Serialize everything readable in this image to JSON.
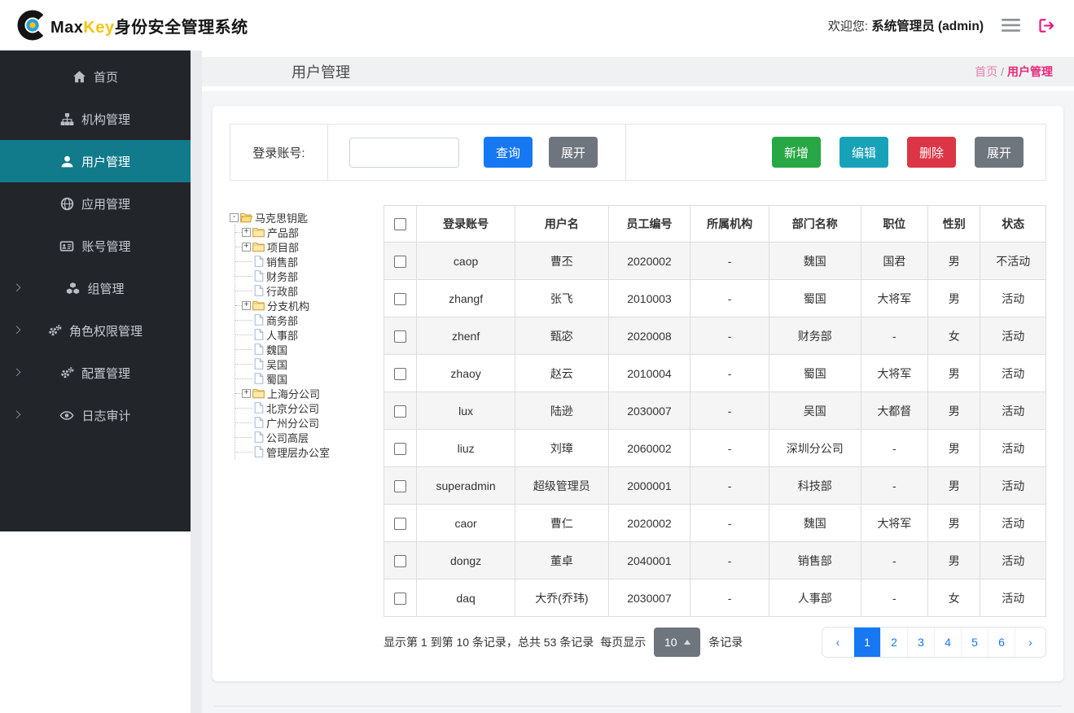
{
  "colors": {
    "primary_blue": "#1678f2",
    "success_green": "#28a745",
    "info_teal": "#17a2b8",
    "danger_red": "#dc3545",
    "secondary_gray": "#6e757c",
    "sidebar_active_teal": "#117a8b",
    "brand_pink": "#e72a7a",
    "brand_yellow": "#f3c414",
    "sidebar_bg": "#22262b"
  },
  "header": {
    "logo_max": "Max",
    "logo_key": "Key",
    "logo_suffix": "身份安全管理系统",
    "welcome_prefix": "欢迎您:",
    "welcome_user": "系统管理员 (admin)"
  },
  "sidebar": {
    "items": [
      {
        "key": "home",
        "label": "首页",
        "icon": "home-icon",
        "active": false,
        "has_chevron": false
      },
      {
        "key": "org-mgmt",
        "label": "机构管理",
        "icon": "sitemap-icon",
        "active": false,
        "has_chevron": false
      },
      {
        "key": "user-mgmt",
        "label": "用户管理",
        "icon": "user-icon",
        "active": true,
        "has_chevron": false
      },
      {
        "key": "app-mgmt",
        "label": "应用管理",
        "icon": "globe-icon",
        "active": false,
        "has_chevron": false
      },
      {
        "key": "account-mgmt",
        "label": "账号管理",
        "icon": "id-card-icon",
        "active": false,
        "has_chevron": false
      },
      {
        "key": "group-mgmt",
        "label": "组管理",
        "icon": "cubes-icon",
        "active": false,
        "has_chevron": true
      },
      {
        "key": "role-perm",
        "label": "角色权限管理",
        "icon": "gears-icon",
        "active": false,
        "has_chevron": true
      },
      {
        "key": "config-mgmt",
        "label": "配置管理",
        "icon": "gears-icon",
        "active": false,
        "has_chevron": true
      },
      {
        "key": "audit-log",
        "label": "日志审计",
        "icon": "eye-icon",
        "active": false,
        "has_chevron": true
      }
    ]
  },
  "page": {
    "title": "用户管理",
    "breadcrumb": {
      "home": "首页",
      "separator": "/",
      "current": "用户管理"
    }
  },
  "toolbar": {
    "search_label": "登录账号:",
    "search_value": "",
    "query_label": "查询",
    "expand_label": "展开",
    "add_label": "新增",
    "edit_label": "编辑",
    "delete_label": "删除",
    "expand2_label": "展开"
  },
  "tree": {
    "nodes": [
      {
        "label": "马克思钥匙",
        "type": "folder-open",
        "toggle": "minus",
        "level": 0
      },
      {
        "label": "产品部",
        "type": "folder",
        "toggle": "plus",
        "level": 1
      },
      {
        "label": "项目部",
        "type": "folder",
        "toggle": "plus",
        "level": 1
      },
      {
        "label": "销售部",
        "type": "leaf",
        "toggle": "",
        "level": 1
      },
      {
        "label": "财务部",
        "type": "leaf",
        "toggle": "",
        "level": 1
      },
      {
        "label": "行政部",
        "type": "leaf",
        "toggle": "",
        "level": 1
      },
      {
        "label": "分支机构",
        "type": "folder",
        "toggle": "plus",
        "level": 1
      },
      {
        "label": "商务部",
        "type": "leaf",
        "toggle": "",
        "level": 1
      },
      {
        "label": "人事部",
        "type": "leaf",
        "toggle": "",
        "level": 1
      },
      {
        "label": "魏国",
        "type": "leaf",
        "toggle": "",
        "level": 1
      },
      {
        "label": "吴国",
        "type": "leaf",
        "toggle": "",
        "level": 1
      },
      {
        "label": "蜀国",
        "type": "leaf",
        "toggle": "",
        "level": 1
      },
      {
        "label": "上海分公司",
        "type": "folder",
        "toggle": "plus",
        "level": 1
      },
      {
        "label": "北京分公司",
        "type": "leaf",
        "toggle": "",
        "level": 1
      },
      {
        "label": "广州分公司",
        "type": "leaf",
        "toggle": "",
        "level": 1
      },
      {
        "label": "公司高层",
        "type": "leaf",
        "toggle": "",
        "level": 1
      },
      {
        "label": "管理层办公室",
        "type": "leaf",
        "toggle": "",
        "level": 1
      }
    ]
  },
  "table": {
    "columns": [
      "登录账号",
      "用户名",
      "员工编号",
      "所属机构",
      "部门名称",
      "职位",
      "性别",
      "状态"
    ],
    "rows": [
      [
        "caop",
        "曹丕",
        "2020002",
        "-",
        "魏国",
        "国君",
        "男",
        "不活动"
      ],
      [
        "zhangf",
        "张飞",
        "2010003",
        "-",
        "蜀国",
        "大将军",
        "男",
        "活动"
      ],
      [
        "zhenf",
        "甄宓",
        "2020008",
        "-",
        "财务部",
        "-",
        "女",
        "活动"
      ],
      [
        "zhaoy",
        "赵云",
        "2010004",
        "-",
        "蜀国",
        "大将军",
        "男",
        "活动"
      ],
      [
        "lux",
        "陆逊",
        "2030007",
        "-",
        "吴国",
        "大都督",
        "男",
        "活动"
      ],
      [
        "liuz",
        "刘璋",
        "2060002",
        "-",
        "深圳分公司",
        "-",
        "男",
        "活动"
      ],
      [
        "superadmin",
        "超级管理员",
        "2000001",
        "-",
        "科技部",
        "-",
        "男",
        "活动"
      ],
      [
        "caor",
        "曹仁",
        "2020002",
        "-",
        "魏国",
        "大将军",
        "男",
        "活动"
      ],
      [
        "dongz",
        "董卓",
        "2040001",
        "-",
        "销售部",
        "-",
        "男",
        "活动"
      ],
      [
        "daq",
        "大乔(乔玮)",
        "2030007",
        "-",
        "人事部",
        "-",
        "女",
        "活动"
      ]
    ]
  },
  "pagination": {
    "summary_prefix": "显示第 1 到第 10 条记录，总共 53 条记录",
    "per_page_label": "每页显示",
    "page_size": "10",
    "records_suffix": "条记录",
    "prev": "‹",
    "next": "›",
    "pages": [
      "1",
      "2",
      "3",
      "4",
      "5",
      "6"
    ],
    "active_page": "1"
  }
}
